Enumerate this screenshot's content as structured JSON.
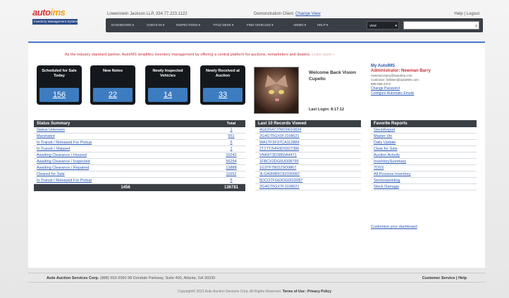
{
  "header": {
    "logo_text_1": "auto",
    "logo_text_2": "ims",
    "logo_tagline": "Inventory Management System",
    "user_line": "Lowenstein Jackson LLP, 334.77.223.1122",
    "dealer_label": "Demonstration Client",
    "change_view": "Change View",
    "help_logout": "Help | Logout"
  },
  "nav": {
    "items": [
      "DASHBOARD ▾",
      "CHECK-IN ▾",
      "INSPECTIONS ▾",
      "TITLE DESK ▾",
      "FIND VEHICLES ▾",
      "ADMIN ▾",
      "HELP ▾"
    ],
    "select_value": "VIN#",
    "search_placeholder": ""
  },
  "banner": {
    "text": "As the industry standard partner, AutoIMS simplifies inventory management by offering a central platform for auctions, remarketers and dealers.",
    "faded": " Learn more »"
  },
  "cards": [
    {
      "label": "Scheduled for Sale Today",
      "value": "156"
    },
    {
      "label": "New Notes",
      "value": "22"
    },
    {
      "label": "Newly Inspected Vehicles",
      "value": "14"
    },
    {
      "label": "Newly Received at Auction",
      "value": "33"
    }
  ],
  "welcome": {
    "text": "Welcome Back Vision Cupello",
    "last_login": "Last Login: 8:17:12"
  },
  "my_autoims": {
    "title": "My AutoIMS",
    "role": "Administrator: Newman Barry",
    "email": "newman.barry@autoims.com",
    "customer": "Customer: beblem@autoIMS.com",
    "phone": "888-555-2372",
    "links": [
      "Change Password",
      "Configure Automatic Emails"
    ]
  },
  "status_summary": {
    "title": "Status Summary",
    "total_label": "Total",
    "rows": [
      {
        "label": "Status Unknown",
        "value": "1"
      },
      {
        "label": "Marshaled",
        "value": "551"
      },
      {
        "label": "In Transit / Released For Pickup",
        "value": "5"
      },
      {
        "label": "In Transit / Shipped",
        "value": "1"
      },
      {
        "label": "Awaiting Clearance / Housed",
        "value": "10242"
      },
      {
        "label": "Awaiting Clearance / Inspected",
        "value": "56294"
      },
      {
        "label": "Awaiting Clearance / Repaired",
        "value": "13888"
      },
      {
        "label": "Cleared for Sale",
        "value": "11552"
      },
      {
        "label": "In Transit / Released For Pickup",
        "value": "5"
      }
    ],
    "footer_left": "1456",
    "footer_right": "136781"
  },
  "records": {
    "title": "Last 10 Records Viewed",
    "rows": [
      "4G63S47J7MO0610824",
      "2G4GT5GX0FJ108621",
      "WA1TF3F37CA112889",
      "2T1TT2HN3DS927386",
      "VNK8T3D3850A4471",
      "1FBCX2DG0UO08795",
      "1G3TF7802Z9O9867",
      "3LGA0MB5C8Z030087",
      "5DCO7FG63OG0I1D087",
      "2G4GT5GX7FJ108621"
    ]
  },
  "reports": {
    "title": "Favorite Reports",
    "rows": [
      "StockReport",
      "Master Vin",
      "Daily Update",
      "Clear for Sale",
      "Auction Activity",
      "InventorySummary",
      "7DSS",
      "All Possess Inventory",
      "Servicepointing",
      "Stock Damage"
    ],
    "customize": "Customize your dashboard"
  },
  "footer": {
    "company": "Auto Auction Services Corp.",
    "address": "(888) 553-2050 98 Dondale Parkway, Suite 400, Atlanta, GA 30339",
    "customer_service": "Customer Service",
    "help": "Help",
    "copyright": "Copyright© 2012 Auto Auction Services Corp. All Rights Reserved.",
    "terms": "Terms of Use",
    "privacy": "Privacy Policy"
  }
}
